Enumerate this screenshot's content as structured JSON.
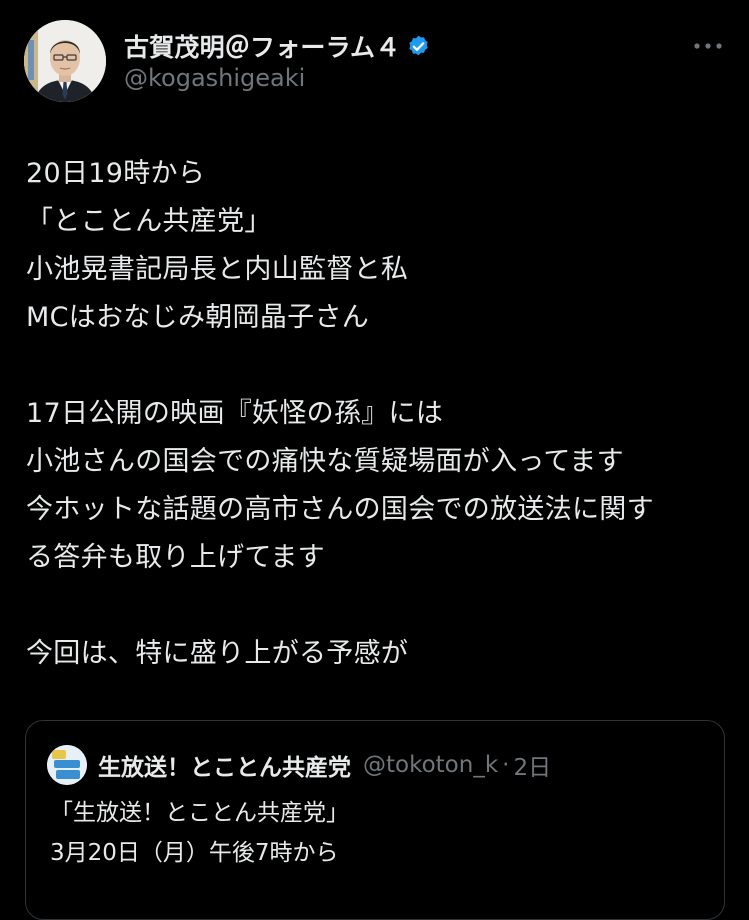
{
  "author": {
    "display_name": "古賀茂明＠フォーラム４",
    "handle": "@kogashigeaki",
    "verified": true
  },
  "tweet": {
    "lines": [
      "20日19時から",
      "「とことん共産党」",
      "小池晃書記局長と内山監督と私",
      "MCはおなじみ朝岡晶子さん",
      "",
      "17日公開の映画『妖怪の孫』には",
      "小池さんの国会での痛快な質疑場面が入ってます",
      "今ホットな話題の高市さんの国会での放送法に関す",
      "る答弁も取り上げてます",
      "",
      "今回は、特に盛り上がる予感が"
    ]
  },
  "quoted_tweet": {
    "display_name": "生放送！とことん共産党",
    "handle": "@tokoton_k",
    "separator": "·",
    "time": "2日",
    "avatar_text": "生放送！とことん共産党",
    "lines": [
      "「生放送！とことん共産党」",
      "3月20日（月）午後7時から"
    ]
  },
  "icons": {
    "more": "more-horizontal-icon",
    "verified": "verified-badge-icon"
  },
  "colors": {
    "background": "#000000",
    "text": "#e7e9ea",
    "secondary_text": "#71767b",
    "verified_blue": "#1d9bf0",
    "border": "#2f3336"
  }
}
